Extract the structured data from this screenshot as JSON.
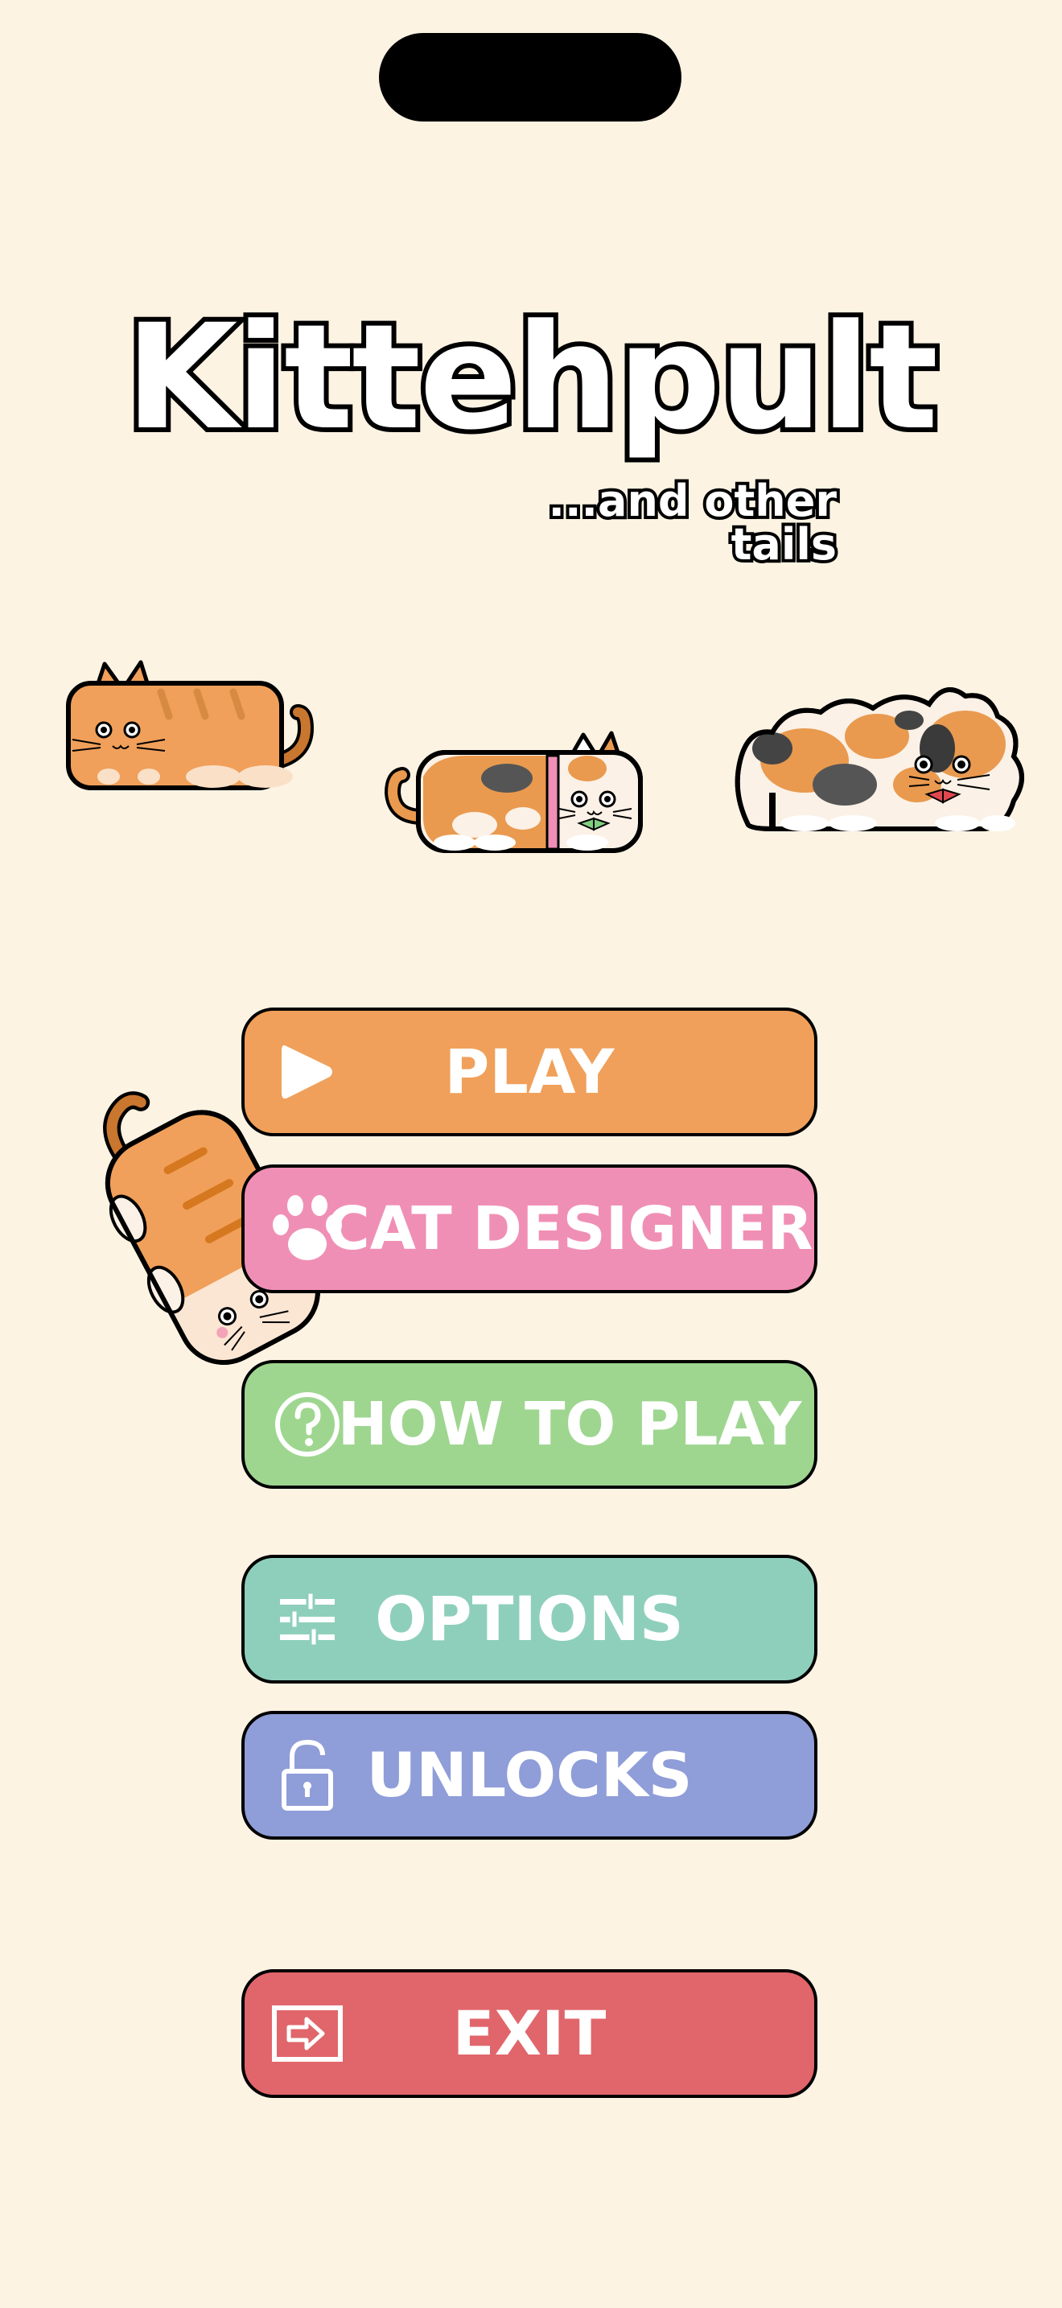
{
  "title": "Kittehpult",
  "subtitle": "...and other tails",
  "menu": {
    "play": "PLAY",
    "cat_designer": "CAT DESIGNER",
    "how_to_play": "HOW TO PLAY",
    "options": "OPTIONS",
    "unlocks": "UNLOCKS",
    "exit": "EXIT"
  },
  "icons": {
    "play": "play-icon",
    "cat_designer": "paw-icon",
    "how_to_play": "question-icon",
    "options": "sliders-icon",
    "unlocks": "unlock-icon",
    "exit": "exit-icon"
  },
  "colors": {
    "background": "#fcf3e3",
    "play": "#f0a05a",
    "cat_designer": "#f08fb5",
    "how_to_play": "#9ed690",
    "options": "#8ecfbb",
    "unlocks": "#8f9dd8",
    "exit": "#e0666b"
  }
}
